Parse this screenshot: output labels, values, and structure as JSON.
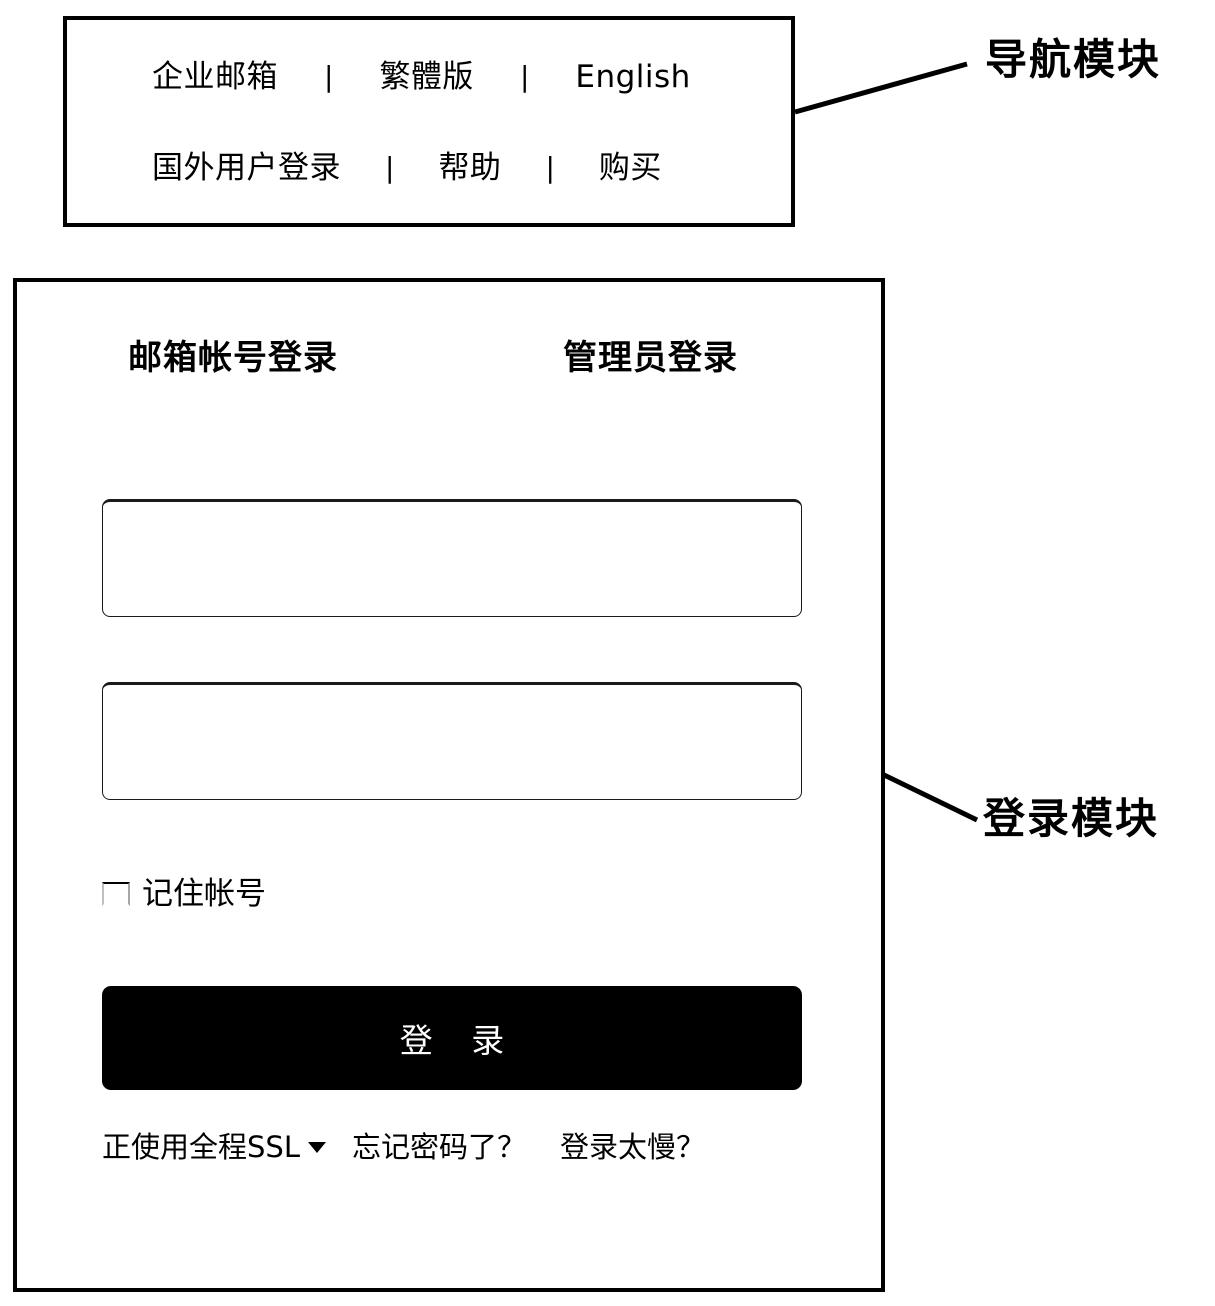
{
  "nav_module": {
    "row1": [
      {
        "label": "企业邮箱"
      },
      {
        "label": "繁體版"
      },
      {
        "label": "English"
      }
    ],
    "row2": [
      {
        "label": "国外用户登录"
      },
      {
        "label": "帮助"
      },
      {
        "label": "购买"
      }
    ],
    "separator": "|"
  },
  "login_module": {
    "tabs": [
      {
        "label": "邮箱帐号登录",
        "selected": true
      },
      {
        "label": "管理员登录",
        "selected": false
      }
    ],
    "fields": {
      "account": {
        "value": "",
        "placeholder": ""
      },
      "password": {
        "value": "",
        "placeholder": ""
      }
    },
    "remember": {
      "label": "记住帐号",
      "checked": false
    },
    "submit": {
      "label": "登 录"
    },
    "footer": {
      "ssl": "正使用全程SSL",
      "forgot": "忘记密码了？",
      "slow": "登录太慢？"
    }
  },
  "callouts": {
    "nav": "导航模块",
    "login": "登录模块"
  },
  "colors": {
    "outline": "#000000",
    "button_bg": "#000000",
    "button_text": "#ffffff",
    "page_bg": "#ffffff"
  }
}
